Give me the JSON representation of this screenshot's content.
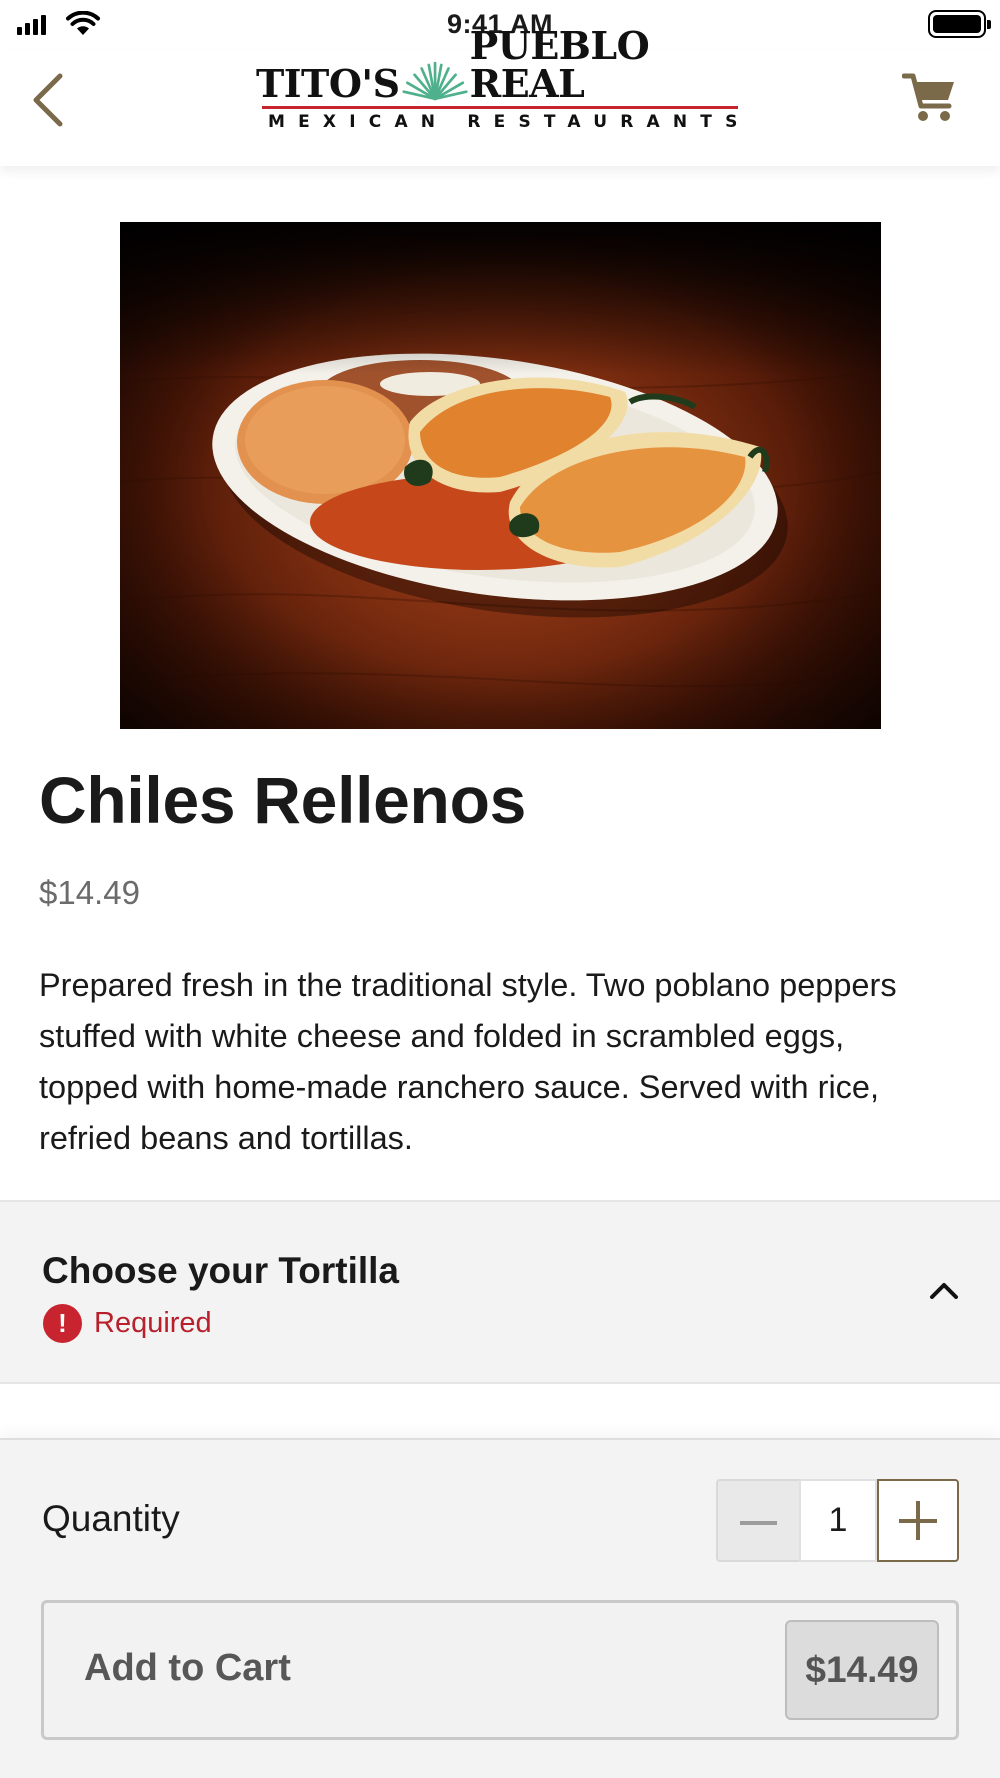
{
  "status_bar": {
    "time": "9:41 AM"
  },
  "header": {
    "logo_line1_left": "TITO'S",
    "logo_line1_right": "PUEBLO REAL",
    "logo_line2": "MEXICAN RESTAURANTS",
    "back_icon": "chevron-left-icon",
    "cart_icon": "shopping-cart-icon"
  },
  "item": {
    "name": "Chiles Rellenos",
    "price": "$14.49",
    "description": "Prepared fresh in the traditional style. Two poblano peppers stuffed with white cheese and folded in scrambled eggs, topped with home-made ranchero sauce. Served with rice, refried beans and tortillas."
  },
  "option": {
    "title": "Choose your Tortilla",
    "required_label": "Required",
    "required_icon": "!",
    "expanded": true
  },
  "footer": {
    "quantity_label": "Quantity",
    "quantity_value": "1",
    "add_label": "Add to Cart",
    "add_price": "$14.49"
  },
  "colors": {
    "brand_accent": "#7a6a4a",
    "required_red": "#c8242f",
    "logo_rule": "#c8242f",
    "section_bg": "#f3f3f3"
  }
}
